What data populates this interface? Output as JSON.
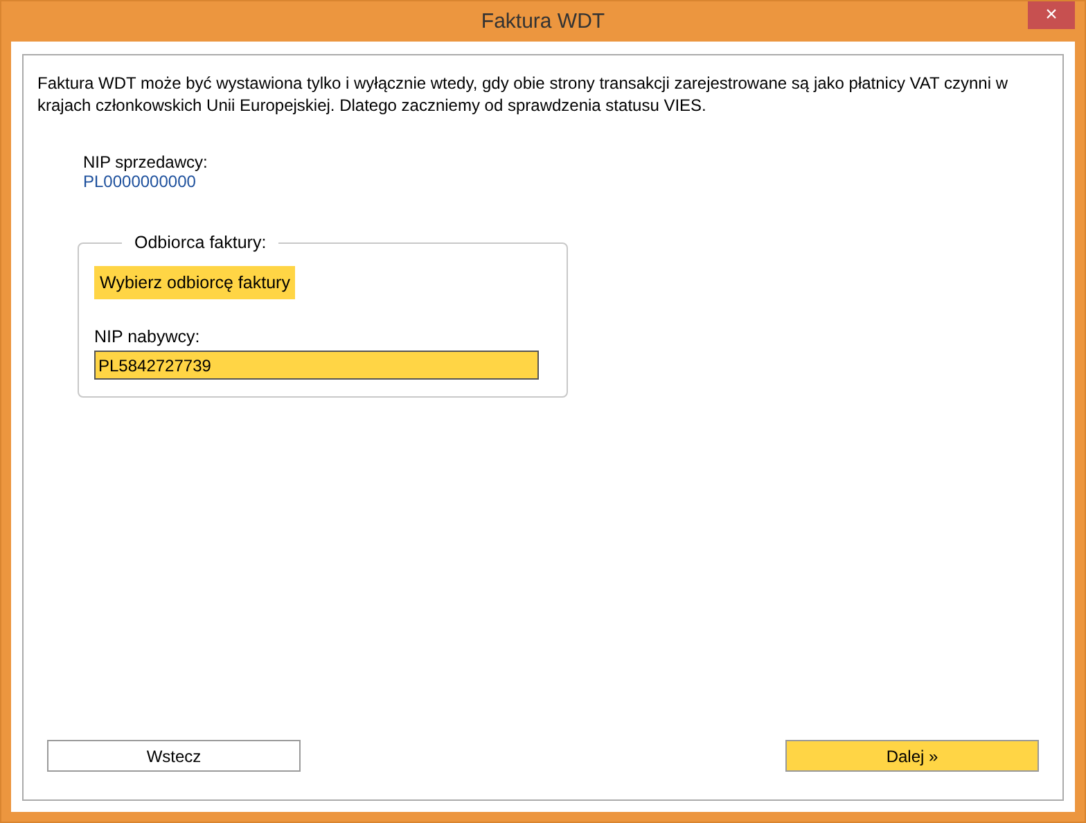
{
  "window": {
    "title": "Faktura WDT",
    "close": "×"
  },
  "intro": "Faktura WDT może być wystawiona tylko i wyłącznie wtedy, gdy obie strony transakcji zarejestrowane są jako płatnicy VAT czynni w krajach członkowskich Unii Europejskiej. Dlatego zaczniemy od sprawdzenia statusu VIES.",
  "seller": {
    "label": "NIP sprzedawcy:",
    "value": "PL0000000000"
  },
  "recipient_group": {
    "legend": "Odbiorca faktury:",
    "choose_button": "Wybierz odbiorcę faktury",
    "nip_label": "NIP nabywcy:",
    "nip_value": "PL5842727739"
  },
  "buttons": [
    {
      "label": "Wstecz",
      "primary": false
    },
    {
      "label": "Dalej »",
      "primary": true
    }
  ]
}
